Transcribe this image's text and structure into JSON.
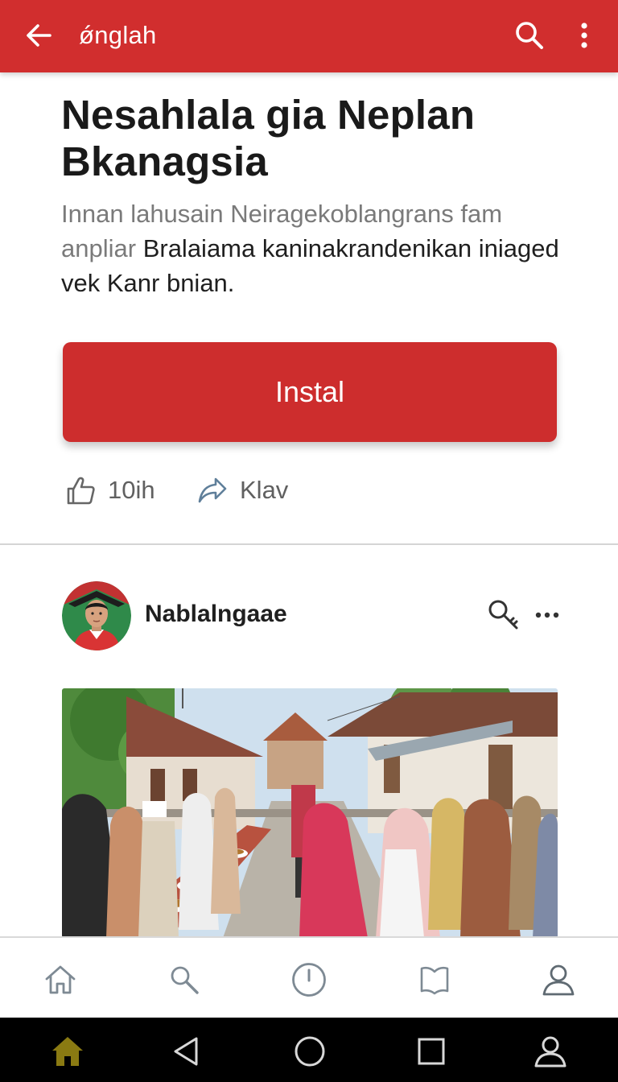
{
  "topbar": {
    "title": "ǿnglah",
    "back_icon": "arrow-left-icon",
    "search_icon": "search-icon",
    "more_icon": "more-vertical-icon",
    "color": "#d12e2e"
  },
  "article": {
    "headline": "Nesahlala gia Neplan Bkanagsia",
    "lead_muted": "Innan lahusain Neiragekoblangrans fam anpliar ",
    "lead_strong": "Bralaiama kaninakrandenikan iniaged vek Kanr bnian.",
    "install_label": "Instal",
    "accent": "#cd2d2d",
    "like_count": "10ih",
    "share_label": "Klav"
  },
  "post": {
    "username": "Nablalngaae",
    "key_icon": "key-search-icon",
    "more_icon": "more-horizontal-icon",
    "avatar": "avatar",
    "photo": "street-market-photo"
  },
  "bottom_nav": {
    "items": [
      {
        "icon": "home-icon"
      },
      {
        "icon": "search-icon"
      },
      {
        "icon": "clock-icon"
      },
      {
        "icon": "bookmark-icon"
      },
      {
        "icon": "profile-icon"
      }
    ]
  },
  "system_nav": {
    "items": [
      {
        "icon": "home-icon",
        "color": "#8a7a12"
      },
      {
        "icon": "back-triangle-icon"
      },
      {
        "icon": "circle-home-icon"
      },
      {
        "icon": "recents-square-icon"
      },
      {
        "icon": "profile-icon"
      }
    ]
  }
}
